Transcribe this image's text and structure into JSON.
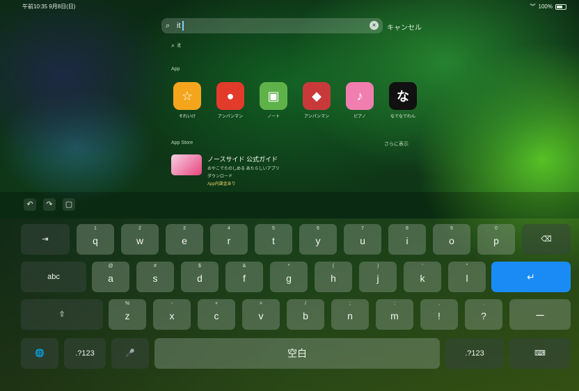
{
  "status": {
    "left": "午前10:35 9月8日(日)",
    "right": "100%"
  },
  "search": {
    "value": "it",
    "cancel": "キャンセル",
    "clear_icon": "clear-icon"
  },
  "suggestion": "it",
  "sections": {
    "apps": "App",
    "store": "App Store",
    "show_more": "さらに表示"
  },
  "apps": [
    {
      "label": "それいけ",
      "color": "#f5a51c",
      "glyph": "☆"
    },
    {
      "label": "アンパンマン",
      "color": "#e23b2b",
      "glyph": "●"
    },
    {
      "label": "ノート",
      "color": "#5fb24a",
      "glyph": "▣"
    },
    {
      "label": "アンパンマン",
      "color": "#c83a3a",
      "glyph": "◆"
    },
    {
      "label": "ピアノ",
      "color": "#f07fb0",
      "glyph": "♪"
    },
    {
      "label": "なでなでわん",
      "color": "#111111",
      "glyph": "な"
    }
  ],
  "store_item": {
    "title": "ノースサイド 公式ガイド",
    "line1": "おやこでたのしめる あたらしいアプリ",
    "line2": "ダウンロード",
    "line3": "App内課金あり"
  },
  "shortcuts": [
    "↶",
    "↷",
    "▢"
  ],
  "keyboard": {
    "row1": [
      {
        "main": "q",
        "sub": "1"
      },
      {
        "main": "w",
        "sub": "2"
      },
      {
        "main": "e",
        "sub": "3"
      },
      {
        "main": "r",
        "sub": "4"
      },
      {
        "main": "t",
        "sub": "5"
      },
      {
        "main": "y",
        "sub": "6"
      },
      {
        "main": "u",
        "sub": "7"
      },
      {
        "main": "i",
        "sub": "8"
      },
      {
        "main": "o",
        "sub": "9"
      },
      {
        "main": "p",
        "sub": "0"
      }
    ],
    "row2": [
      {
        "main": "a",
        "sub": "@"
      },
      {
        "main": "s",
        "sub": "#"
      },
      {
        "main": "d",
        "sub": "$"
      },
      {
        "main": "f",
        "sub": "&"
      },
      {
        "main": "g",
        "sub": "*"
      },
      {
        "main": "h",
        "sub": "("
      },
      {
        "main": "j",
        "sub": ")"
      },
      {
        "main": "k",
        "sub": "'"
      },
      {
        "main": "l",
        "sub": "\""
      }
    ],
    "row3": [
      {
        "main": "z",
        "sub": "%"
      },
      {
        "main": "x",
        "sub": "-"
      },
      {
        "main": "c",
        "sub": "+"
      },
      {
        "main": "v",
        "sub": "="
      },
      {
        "main": "b",
        "sub": "/"
      },
      {
        "main": "n",
        "sub": ";"
      },
      {
        "main": "m",
        "sub": ":"
      },
      {
        "main": "!",
        "sub": ","
      },
      {
        "main": "?",
        "sub": "."
      },
      {
        "main": "ー",
        "sub": ""
      }
    ],
    "tab": "⇥",
    "delete": "⌫",
    "abc": "abc",
    "return": "↵",
    "shift": "⇧",
    "globe": "🌐",
    "num_left": ".?123",
    "mic": "🎤",
    "space": "空白",
    "num_right": ".?123",
    "hide": "⌨"
  },
  "colors": {
    "return_key": "#1a8bf5",
    "caret": "#7ad0ff"
  }
}
